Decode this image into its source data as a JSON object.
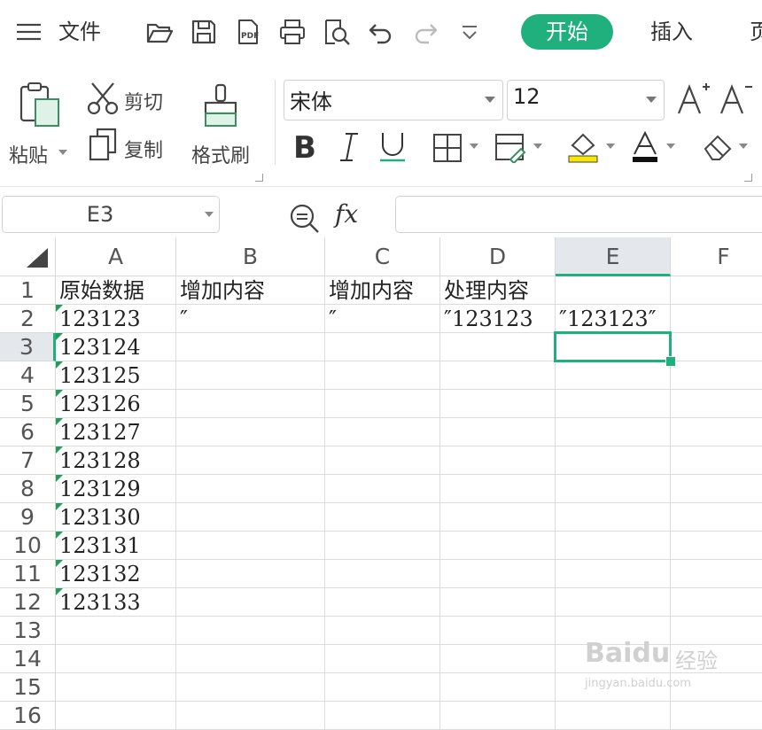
{
  "topbar": {
    "menu_label": "文件",
    "tabs": [
      {
        "label": "开始",
        "active": true
      },
      {
        "label": "插入",
        "active": false
      },
      {
        "label": "页",
        "active": false
      }
    ],
    "icons": [
      "menu-icon",
      "open-folder-icon",
      "save-icon",
      "export-pdf-icon",
      "print-icon",
      "print-preview-icon",
      "undo-icon",
      "redo-icon",
      "more-dropdown-icon"
    ]
  },
  "ribbon": {
    "paste_label": "粘贴",
    "cut_label": "剪切",
    "copy_label": "复制",
    "format_painter_label": "格式刷",
    "font_name": "宋体",
    "font_size": "12"
  },
  "formula_bar": {
    "name_box": "E3",
    "fx_label": "fx",
    "formula": ""
  },
  "sheet": {
    "columns": [
      "A",
      "B",
      "C",
      "D",
      "E",
      "F"
    ],
    "rows": [
      "1",
      "2",
      "3",
      "4",
      "5",
      "6",
      "7",
      "8",
      "9",
      "10",
      "11",
      "12",
      "13",
      "14",
      "15",
      "16"
    ],
    "selected_col": "E",
    "selected_row": "3",
    "cells": [
      [
        "原始数据",
        "增加内容",
        "增加内容",
        "处理内容",
        "",
        ""
      ],
      [
        "123123",
        "″",
        "″",
        "″123123",
        "″123123″",
        ""
      ],
      [
        "123124",
        "",
        "",
        "",
        "",
        ""
      ],
      [
        "123125",
        "",
        "",
        "",
        "",
        ""
      ],
      [
        "123126",
        "",
        "",
        "",
        "",
        ""
      ],
      [
        "123127",
        "",
        "",
        "",
        "",
        ""
      ],
      [
        "123128",
        "",
        "",
        "",
        "",
        ""
      ],
      [
        "123129",
        "",
        "",
        "",
        "",
        ""
      ],
      [
        "123130",
        "",
        "",
        "",
        "",
        ""
      ],
      [
        "123131",
        "",
        "",
        "",
        "",
        ""
      ],
      [
        "123132",
        "",
        "",
        "",
        "",
        ""
      ],
      [
        "123133",
        "",
        "",
        "",
        "",
        ""
      ],
      [
        "",
        "",
        "",
        "",
        "",
        ""
      ],
      [
        "",
        "",
        "",
        "",
        "",
        ""
      ],
      [
        "",
        "",
        "",
        "",
        "",
        ""
      ],
      [
        "",
        "",
        "",
        "",
        "",
        ""
      ]
    ],
    "text_number_rows": [
      2,
      3,
      4,
      5,
      6,
      7,
      8,
      9,
      10,
      11,
      12
    ]
  },
  "watermark": {
    "brand": "Baidu",
    "cn": "经验",
    "url": "jingyan.baidu.com"
  },
  "colors": {
    "accent": "#1fb07d",
    "header_selected": "#e4e7ec",
    "text_flag": "#1f9b57"
  }
}
